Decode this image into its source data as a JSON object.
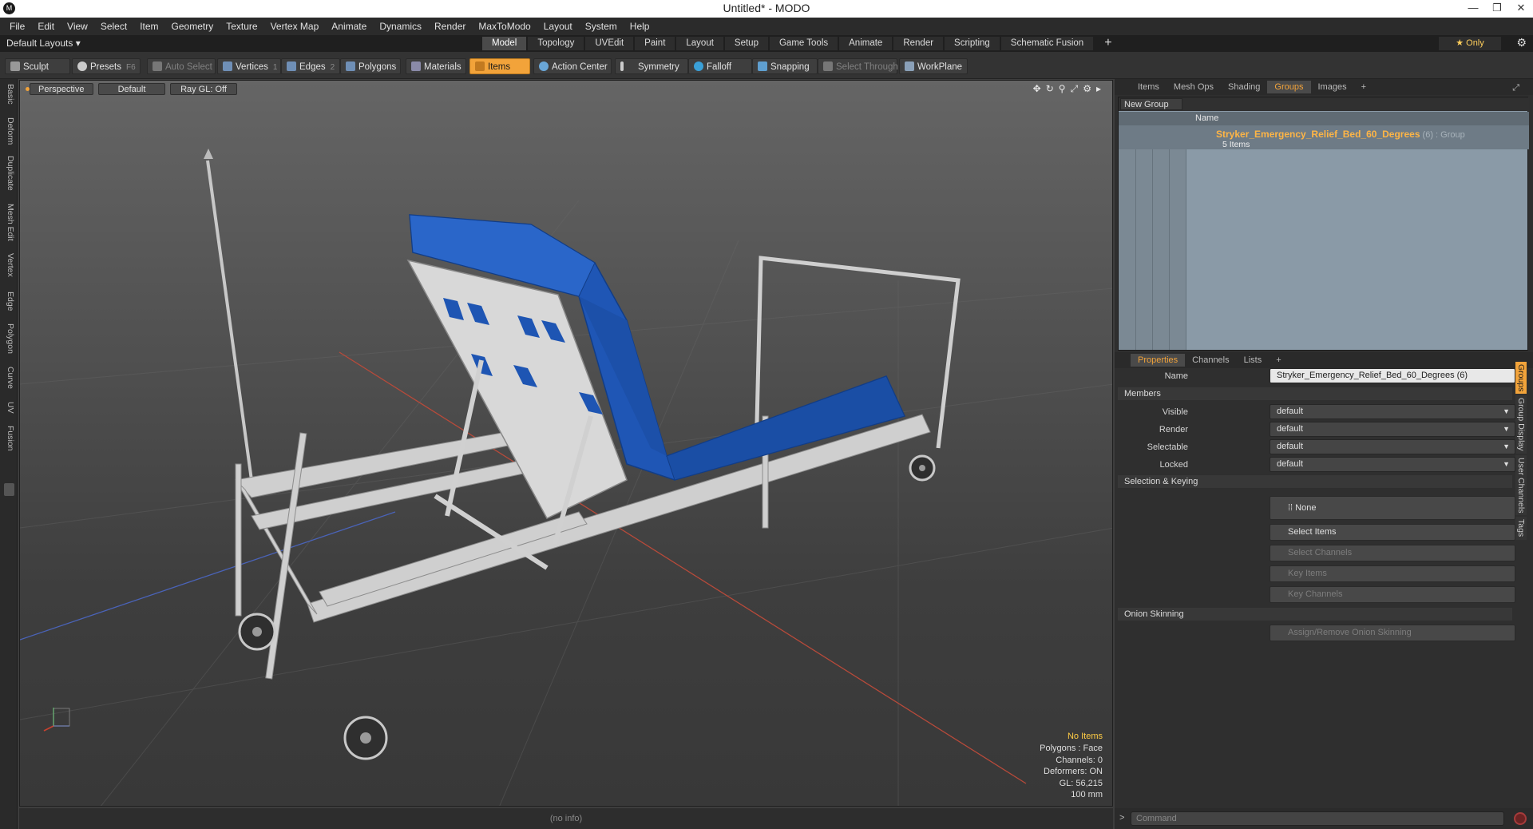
{
  "titlebar": {
    "app_icon": "M",
    "title": "Untitled* - MODO",
    "buttons": [
      "—",
      "❐",
      "✕"
    ]
  },
  "menu": [
    "File",
    "Edit",
    "View",
    "Select",
    "Item",
    "Geometry",
    "Texture",
    "Vertex Map",
    "Animate",
    "Dynamics",
    "Render",
    "MaxToModo",
    "Layout",
    "System",
    "Help"
  ],
  "layoutbar": {
    "layouts": "Default Layouts ▾",
    "tabs": [
      "Model",
      "Topology",
      "UVEdit",
      "Paint",
      "Layout",
      "Setup",
      "Game Tools",
      "Animate",
      "Render",
      "Scripting",
      "Schematic Fusion"
    ],
    "active_tab": "Model",
    "plus": "+",
    "only": "★  Only",
    "gear": "⚙"
  },
  "toolbar": {
    "sculpt": "Sculpt",
    "presets": "Presets",
    "presets_key": "F6",
    "auto_select": "Auto Select",
    "vertices": "Vertices",
    "vertices_num": "1",
    "edges": "Edges",
    "edges_num": "2",
    "polygons": "Polygons",
    "materials": "Materials",
    "items": "Items",
    "action_center": "Action Center",
    "symmetry": "Symmetry",
    "falloff": "Falloff",
    "snapping": "Snapping",
    "select_through": "Select Through",
    "workplane": "WorkPlane"
  },
  "left_tabs": [
    "Basic",
    "Deform",
    "Duplicate",
    "Mesh Edit",
    "Vertex",
    "Edge",
    "Polygon",
    "Curve",
    "UV",
    "Fusion"
  ],
  "viewport": {
    "view": "Perspective",
    "shading": "Default",
    "raygl": "Ray GL: Off",
    "icons": [
      "✥",
      "↻",
      "⚲",
      "⤢",
      "⚙",
      "▸"
    ],
    "info": [
      "No Items",
      "Polygons : Face",
      "Channels: 0",
      "Deformers: ON",
      "GL: 56,215",
      "100 mm"
    ]
  },
  "status": "(no info)",
  "top_panel": {
    "tabs": [
      "Items",
      "Mesh Ops",
      "Shading",
      "Groups",
      "Images"
    ],
    "active": "Groups",
    "new_group": "New Group",
    "col_name": "Name",
    "group_name": "Stryker_Emergency_Relief_Bed_60_Degrees",
    "group_suffix": " (6) : Group",
    "group_count": "5 Items"
  },
  "props_panel": {
    "tabs": [
      "Properties",
      "Channels",
      "Lists"
    ],
    "active": "Properties",
    "name_label": "Name",
    "name_value": "Stryker_Emergency_Relief_Bed_60_Degrees (6)",
    "members": "Members",
    "visible_label": "Visible",
    "visible_value": "default",
    "render_label": "Render",
    "render_value": "default",
    "selectable_label": "Selectable",
    "selectable_value": "default",
    "locked_label": "Locked",
    "locked_value": "default",
    "selection_keying": "Selection & Keying",
    "none": "None",
    "select_items": "Select Items",
    "select_channels": "Select Channels",
    "key_items": "Key Items",
    "key_channels": "Key Channels",
    "onion": "Onion Skinning",
    "assign_onion": "Assign/Remove Onion Skinning"
  },
  "side_tabs": [
    "Groups",
    "Group Display",
    "User Channels",
    "Tags"
  ],
  "command": {
    "arrow": ">",
    "placeholder": "Command"
  },
  "colors": {
    "accent": "#f2a33a",
    "mattress": "#1f56b5",
    "frame": "#c9c9c9"
  }
}
